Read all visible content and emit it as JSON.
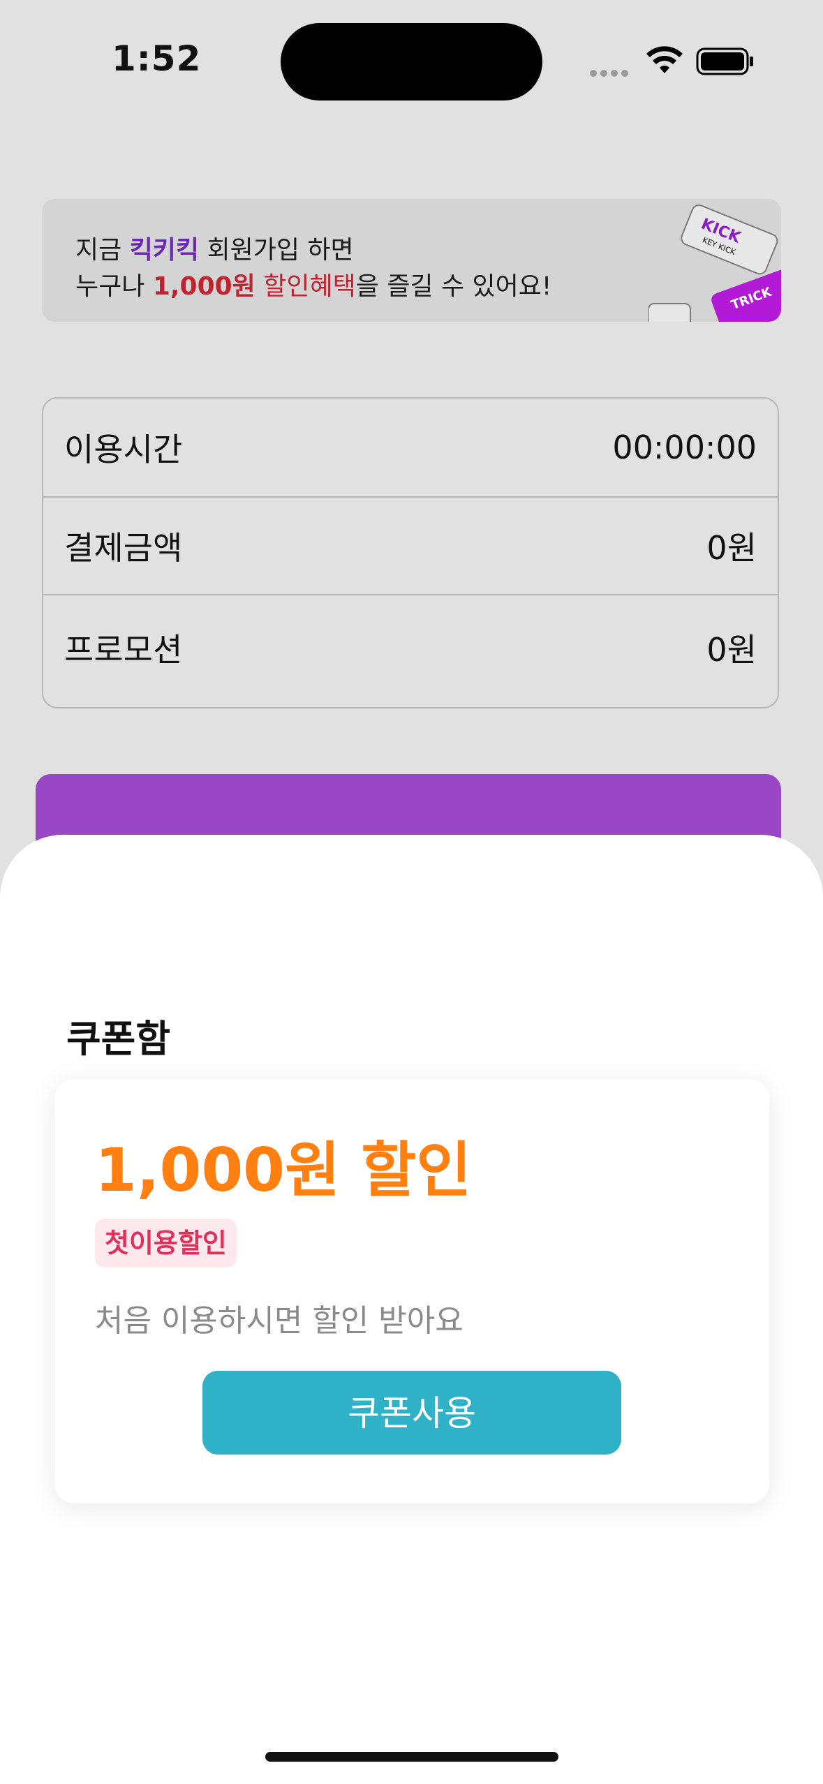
{
  "status_bar": {
    "time": "1:52"
  },
  "promo": {
    "line1_prefix": "지금 ",
    "brand": "킥키킥",
    "line1_suffix": " 회원가입 하면",
    "line2_prefix": "누구나 ",
    "amount": "1,000원",
    "benefit": " 할인혜택",
    "line2_suffix": "을 즐길 수 있어요!",
    "art_labels": [
      "KICK",
      "KEY KICK"
    ]
  },
  "info": {
    "rows": [
      {
        "label": "이용시간",
        "value": "00:00:00"
      },
      {
        "label": "결제금액",
        "value": "0원"
      },
      {
        "label": "프로모션",
        "value": "0원"
      }
    ]
  },
  "sheet": {
    "title": "쿠폰함",
    "coupon": {
      "amount": "1,000원 할인",
      "tag": "첫이용할인",
      "description": "처음 이용하시면 할인 받아요",
      "button_label": "쿠폰사용"
    }
  },
  "colors": {
    "accent_purple": "#9947c4",
    "coupon_orange": "#ff7f10",
    "tag_pink": "#e0305a",
    "button_teal": "#2fb1c8"
  }
}
